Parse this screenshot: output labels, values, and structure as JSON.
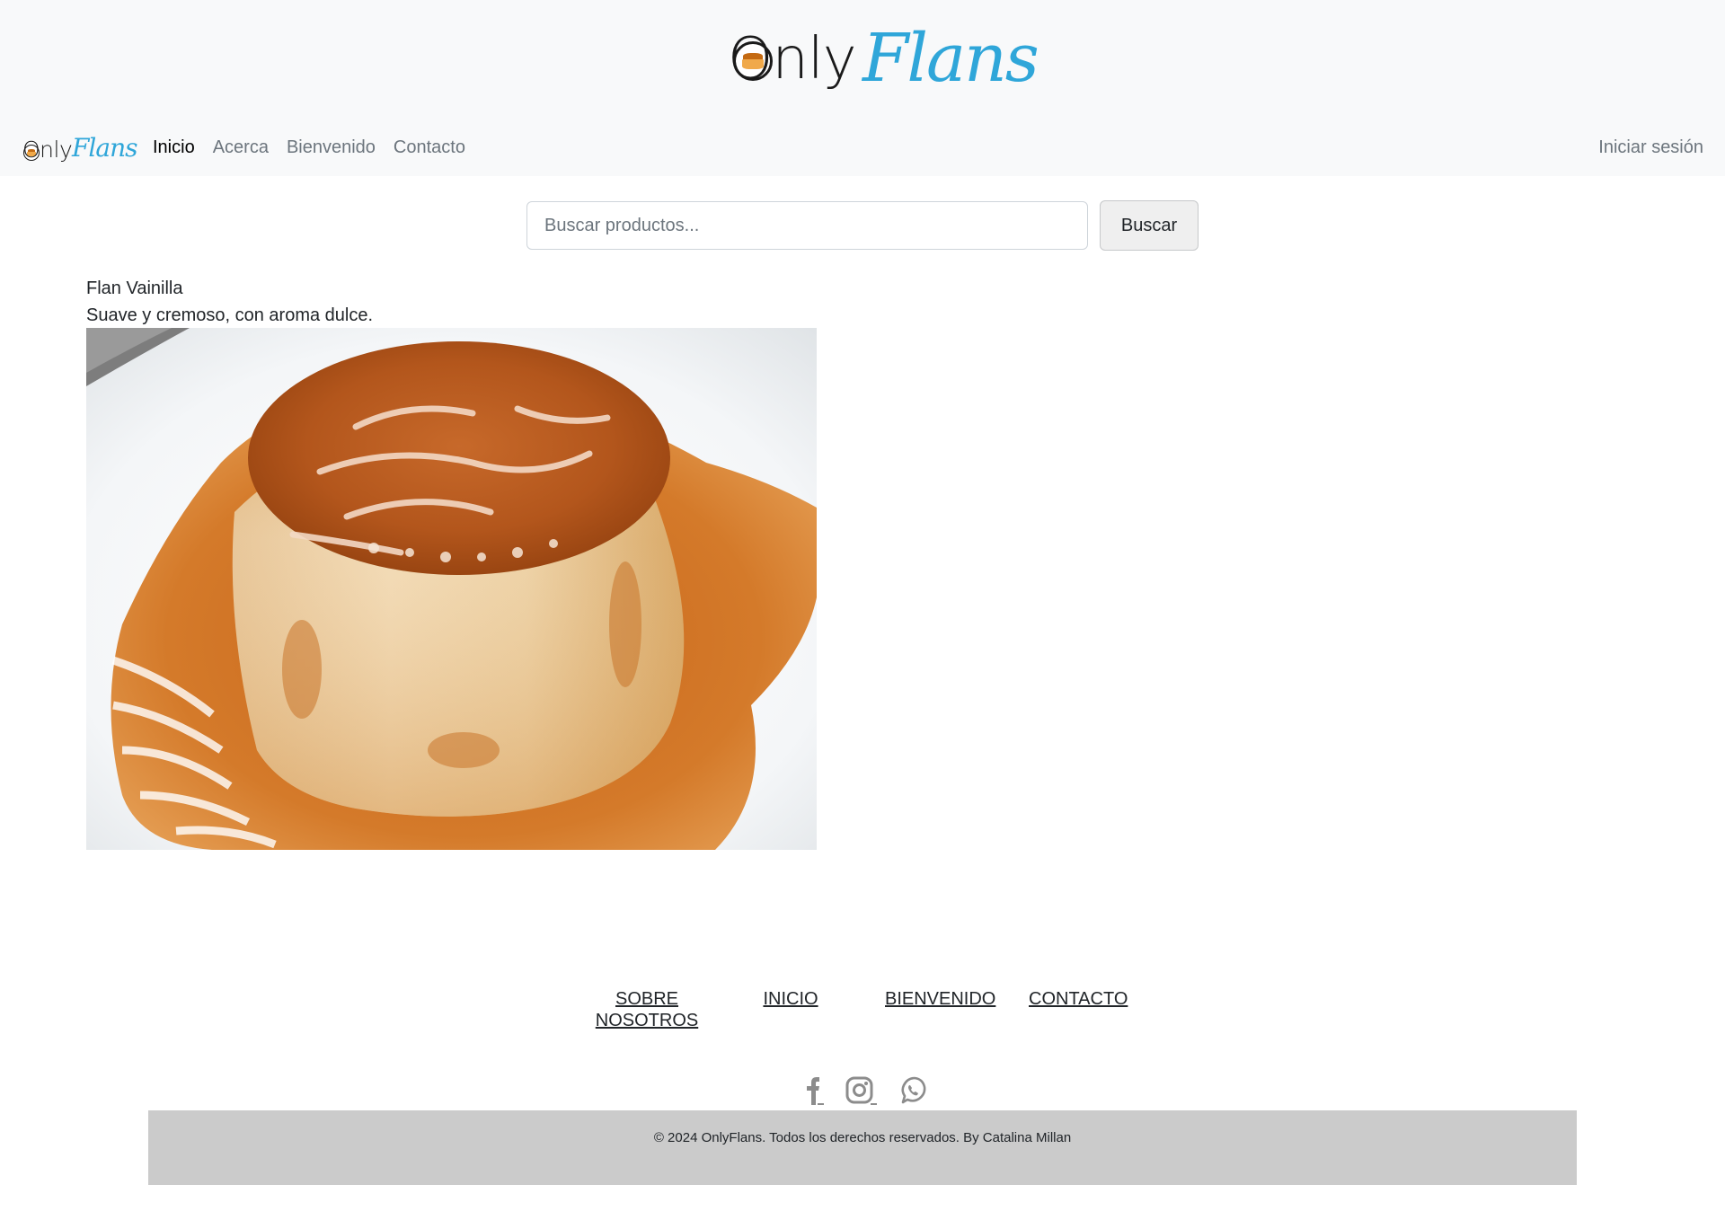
{
  "header": {
    "logo_text_only": "Only",
    "logo_text_flans": "Flans"
  },
  "navbar": {
    "brand_only": "Only",
    "brand_flans": "Flans",
    "links": [
      {
        "label": "Inicio",
        "active": true
      },
      {
        "label": "Acerca",
        "active": false
      },
      {
        "label": "Bienvenido",
        "active": false
      },
      {
        "label": "Contacto",
        "active": false
      }
    ],
    "login_label": "Iniciar sesión"
  },
  "search": {
    "placeholder": "Buscar productos...",
    "value": "",
    "button_label": "Buscar"
  },
  "product": {
    "name": "Flan Vainilla",
    "description": "Suave y cremoso, con aroma dulce."
  },
  "footer": {
    "links": [
      {
        "label_line1": "SOBRE",
        "label_line2": "NOSOTROS"
      },
      {
        "label_line1": "INICIO",
        "label_line2": ""
      },
      {
        "label_line1": "BIENVENIDO",
        "label_line2": ""
      },
      {
        "label_line1": "CONTACTO",
        "label_line2": ""
      }
    ],
    "social": [
      "facebook-icon",
      "instagram-icon",
      "whatsapp-icon"
    ],
    "copyright": "© 2024 OnlyFlans. Todos los derechos reservados. By Catalina Millan"
  },
  "colors": {
    "brand_blue": "#2fa6d9",
    "header_bg": "#f8f9fa",
    "footer_bar_bg": "#cbcbcb",
    "nav_muted": "#6c757d",
    "social_icon": "#8c8c8c"
  }
}
